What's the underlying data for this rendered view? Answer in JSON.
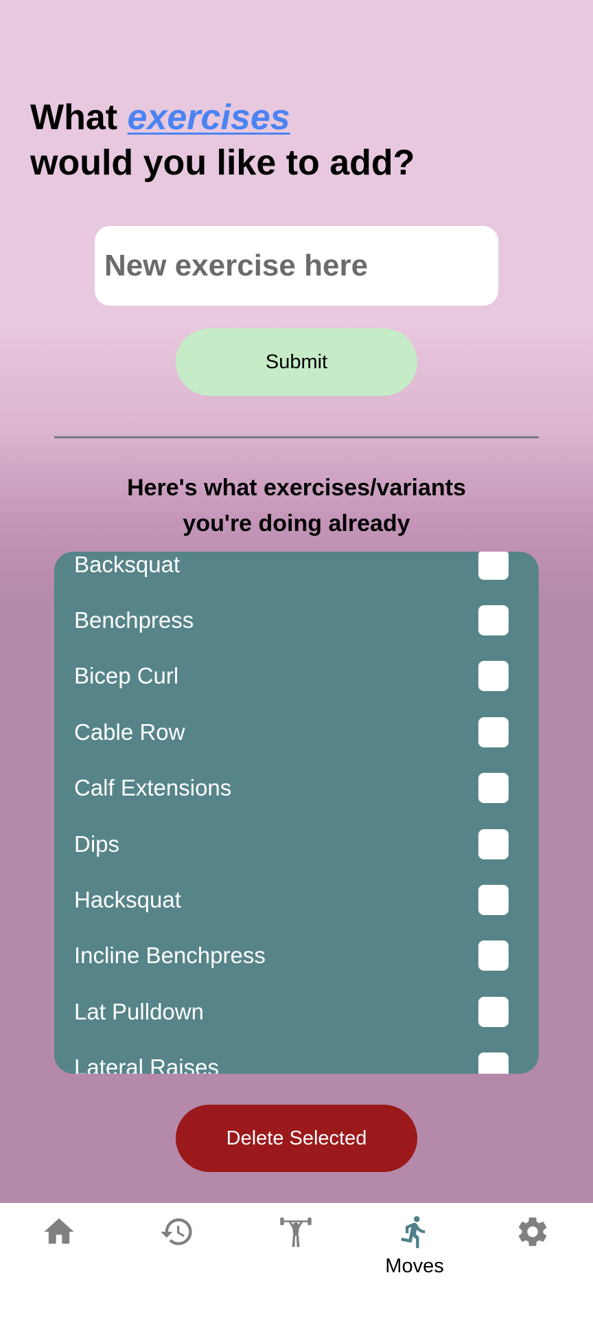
{
  "header": {
    "title_part1": "What ",
    "title_accent": "exercises",
    "title_part2": "would you like to add?"
  },
  "new_exercise": {
    "placeholder": "New exercise here",
    "value": ""
  },
  "submit_label": "Submit",
  "existing": {
    "heading_line1": "Here's what exercises/variants",
    "heading_line2": "you're doing already",
    "items": [
      {
        "label": "Backsquat",
        "checked": false
      },
      {
        "label": "Benchpress",
        "checked": false
      },
      {
        "label": "Bicep Curl",
        "checked": false
      },
      {
        "label": "Cable Row",
        "checked": false
      },
      {
        "label": "Calf Extensions",
        "checked": false
      },
      {
        "label": "Dips",
        "checked": false
      },
      {
        "label": "Hacksquat",
        "checked": false
      },
      {
        "label": "Incline Benchpress",
        "checked": false
      },
      {
        "label": "Lat Pulldown",
        "checked": false
      },
      {
        "label": "Lateral Raises",
        "checked": false
      }
    ]
  },
  "delete_label": "Delete Selected",
  "bottom_nav": {
    "items": [
      {
        "icon": "home-icon",
        "label": "",
        "active": false
      },
      {
        "icon": "history-icon",
        "label": "",
        "active": false
      },
      {
        "icon": "weightlifter-icon",
        "label": "",
        "active": false
      },
      {
        "icon": "running-figure-icon",
        "label": "Moves",
        "active": true
      },
      {
        "icon": "gear-icon",
        "label": "",
        "active": false
      }
    ],
    "active_color": "#4f8088",
    "inactive_color": "#808080"
  },
  "colors": {
    "accent": "#4a83f2",
    "submit_bg": "#c5ecc6",
    "list_bg": "#568489",
    "delete_bg": "#9b191b"
  }
}
